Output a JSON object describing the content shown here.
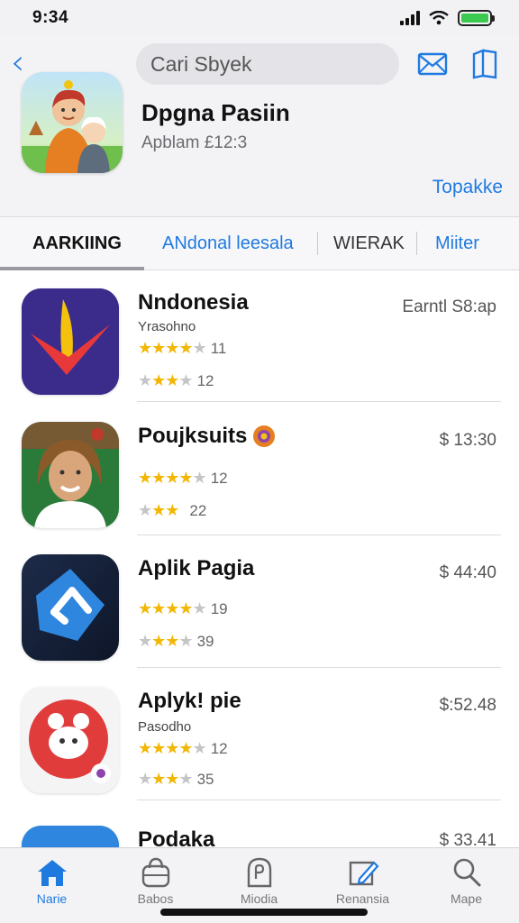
{
  "status_bar": {
    "time": "9:34",
    "battery_color": "#3cc94f"
  },
  "header": {
    "back_icon": "chevron-left-icon",
    "search_text": "Cari Sbyek",
    "mail_icon": "mail-icon",
    "bookmark_icon": "bookmark-icon",
    "app_title": "Dpgna Pasiin",
    "app_subtitle": "Apblam £12:3",
    "get_link": "Topakke",
    "accent_color": "#1f7ae0"
  },
  "tabs": [
    {
      "label": "AARKIING",
      "active": true
    },
    {
      "label": "ANdonal leesala",
      "active": false
    },
    {
      "label": "WIERAK",
      "active": false
    },
    {
      "label": "Miiter",
      "active": false
    }
  ],
  "apps": [
    {
      "name": "Nndonesia",
      "subtitle": "Yrasohno",
      "price": "Earntl S8:ap",
      "rating1": 4,
      "count1": "11",
      "rating2": 3,
      "count2": "12",
      "icon": "app-logo-icon"
    },
    {
      "name": "Poujksuits",
      "subtitle": "",
      "price": "$ 13:30",
      "rating1": 4,
      "count1": "12",
      "rating2": 3,
      "count2": "22",
      "icon": "person-avatar-icon"
    },
    {
      "name": "Aplik Pagia",
      "subtitle": "",
      "price": "$ 44:40",
      "rating1": 4,
      "count1": "19",
      "rating2": 3,
      "count2": "39",
      "icon": "arrow-app-icon"
    },
    {
      "name": "Aplyk! pie",
      "subtitle": "Pasodho",
      "price": "$:52.48",
      "rating1": 4,
      "count1": "12",
      "rating2": 3,
      "count2": "35",
      "icon": "animal-app-icon"
    },
    {
      "name": "Podaka",
      "subtitle": "",
      "price": "$ 33.41",
      "icon": "blue-app-icon"
    }
  ],
  "tabbar": [
    {
      "label": "Narie",
      "icon": "home-icon",
      "active": true
    },
    {
      "label": "Babos",
      "icon": "bag-icon",
      "active": false
    },
    {
      "label": "Miodia",
      "icon": "media-icon",
      "active": false
    },
    {
      "label": "Renansia",
      "icon": "edit-icon",
      "active": false
    },
    {
      "label": "Mape",
      "icon": "search-icon",
      "active": false
    }
  ]
}
